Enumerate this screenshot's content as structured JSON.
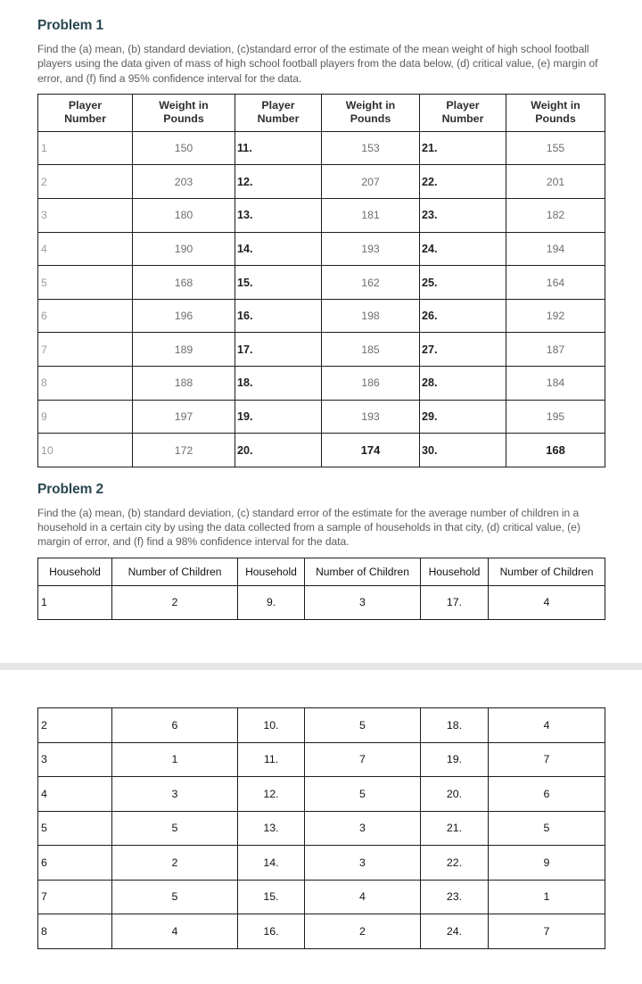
{
  "problem1": {
    "title": "Problem 1",
    "description": "Find the (a) mean,  (b) standard deviation,  (c)standard error of the estimate of the mean weight of high school football players using the data given of mass of high school football players from the data below, (d) critical value, (e) margin of error, and (f) find a 95% confidence interval for the data.",
    "table": {
      "headers": [
        "Player Number",
        "Weight in Pounds",
        "Player Number",
        "Weight in Pounds",
        "Player Number",
        "Weight in Pounds"
      ],
      "header_lines": [
        [
          "Player",
          "Number"
        ],
        [
          "Weight in",
          "Pounds"
        ],
        [
          "Player",
          "Number"
        ],
        [
          "Weight in",
          "Pounds"
        ],
        [
          "Player",
          "Number"
        ],
        [
          "Weight in",
          "Pounds"
        ]
      ],
      "rows": [
        {
          "c0": "1",
          "c1": "150",
          "c2": "11.",
          "c3": "153",
          "c4": "21.",
          "c5": "155"
        },
        {
          "c0": "2",
          "c1": "203",
          "c2": "12.",
          "c3": "207",
          "c4": "22.",
          "c5": "201"
        },
        {
          "c0": "3",
          "c1": "180",
          "c2": "13.",
          "c3": "181",
          "c4": "23.",
          "c5": "182"
        },
        {
          "c0": "4",
          "c1": "190",
          "c2": "14.",
          "c3": "193",
          "c4": "24.",
          "c5": "194"
        },
        {
          "c0": "5",
          "c1": "168",
          "c2": "15.",
          "c3": "162",
          "c4": "25.",
          "c5": "164"
        },
        {
          "c0": "6",
          "c1": "196",
          "c2": "16.",
          "c3": "198",
          "c4": "26.",
          "c5": "192"
        },
        {
          "c0": "7",
          "c1": "189",
          "c2": "17.",
          "c3": "185",
          "c4": "27.",
          "c5": "187"
        },
        {
          "c0": "8",
          "c1": "188",
          "c2": "18.",
          "c3": "186",
          "c4": "28.",
          "c5": "184"
        },
        {
          "c0": "9",
          "c1": "197",
          "c2": "19.",
          "c3": "193",
          "c4": "29.",
          "c5": "195"
        },
        {
          "c0": "10",
          "c1": "172",
          "c2": "20.",
          "c3": "174",
          "c4": "30.",
          "c5": "168"
        }
      ]
    }
  },
  "problem2": {
    "title": "Problem 2",
    "description": "Find the (a) mean,  (b) standard deviation,  (c) standard error of the estimate for the average number of children in a household in a certain city by using the data collected from a sample of households in that city, (d) critical value, (e) margin of error, and (f) find a 98% confidence interval for the data.",
    "table_top": {
      "headers": [
        "Household",
        "Number of Children",
        "Household",
        "Number of Children",
        "Household",
        "Number of Children"
      ],
      "rows": [
        {
          "c0": "1",
          "c1": "2",
          "c2": "9.",
          "c3": "3",
          "c4": "17.",
          "c5": "4"
        }
      ]
    },
    "table_bottom": {
      "rows": [
        {
          "c0": "2",
          "c1": "6",
          "c2": "10.",
          "c3": "5",
          "c4": "18.",
          "c5": "4"
        },
        {
          "c0": "3",
          "c1": "1",
          "c2": "11.",
          "c3": "7",
          "c4": "19.",
          "c5": "7"
        },
        {
          "c0": "4",
          "c1": "3",
          "c2": "12.",
          "c3": "5",
          "c4": "20.",
          "c5": "6"
        },
        {
          "c0": "5",
          "c1": "5",
          "c2": "13.",
          "c3": "3",
          "c4": "21.",
          "c5": "5"
        },
        {
          "c0": "6",
          "c1": "2",
          "c2": "14.",
          "c3": "3",
          "c4": "22.",
          "c5": "9"
        },
        {
          "c0": "7",
          "c1": "5",
          "c2": "15.",
          "c3": "4",
          "c4": "23.",
          "c5": "1"
        },
        {
          "c0": "8",
          "c1": "4",
          "c2": "16.",
          "c3": "2",
          "c4": "24.",
          "c5": "7"
        }
      ]
    }
  },
  "colors": {
    "heading": "#2b4750",
    "body_text": "#5c5c5c",
    "table_border": "#1c1c1c",
    "muted_value": "#6e6e6e",
    "faint_index": "#9a9a9a",
    "page_separator": "#e6e6e6"
  }
}
